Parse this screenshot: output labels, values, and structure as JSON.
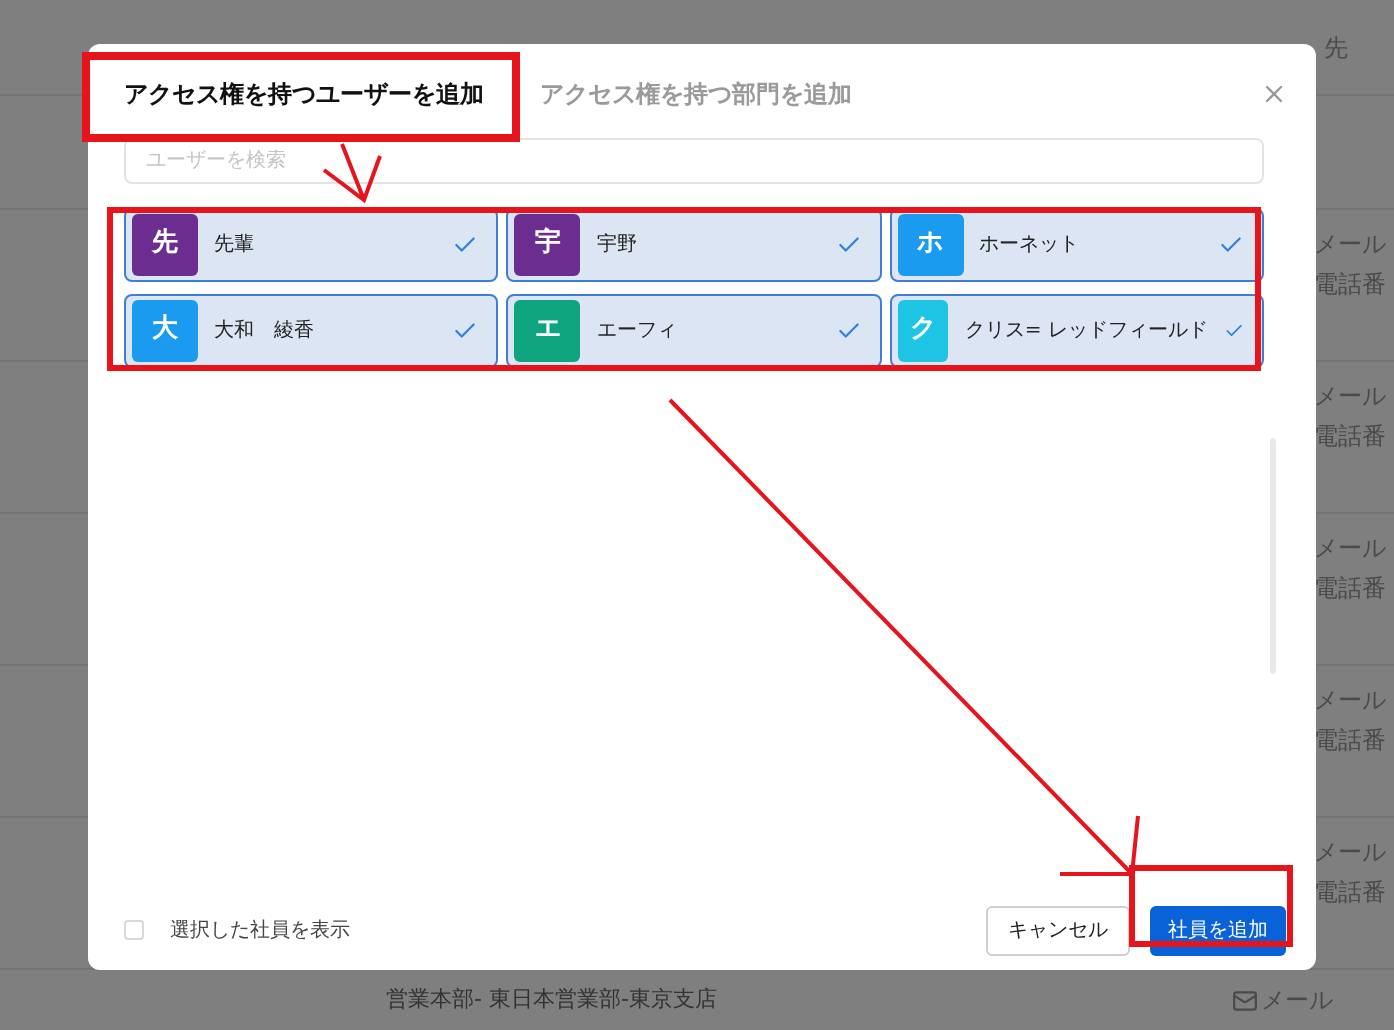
{
  "background": {
    "header_text": "先",
    "rows": [
      {
        "email": "メール",
        "phone": "電話番"
      },
      {
        "email": "メール",
        "phone": "電話番"
      },
      {
        "email": "メール",
        "phone": "電話番"
      },
      {
        "email": "メール",
        "phone": "電話番"
      },
      {
        "email": "メール",
        "phone": "電話番"
      }
    ],
    "last_row": {
      "department": "営業本部- 東日本営業部-東京支店",
      "email": "メール"
    }
  },
  "dialog": {
    "tabs": [
      {
        "label": "アクセス権を持つユーザーを追加",
        "selected": true
      },
      {
        "label": "アクセス権を持つ部門を追加",
        "selected": false
      }
    ],
    "search": {
      "placeholder": "ユーザーを検索"
    },
    "users": [
      {
        "initial": "先",
        "name": "先輩",
        "color": "#6b2d8f",
        "checked": true
      },
      {
        "initial": "宇",
        "name": "宇野",
        "color": "#6b2d8f",
        "checked": true
      },
      {
        "initial": "ホ",
        "name": "ホーネット",
        "color": "#1a9bf0",
        "checked": true
      },
      {
        "initial": "大",
        "name": "大和　綾香",
        "color": "#1a9bf0",
        "checked": true
      },
      {
        "initial": "エ",
        "name": "エーフィ",
        "color": "#0ea47e",
        "checked": true
      },
      {
        "initial": "ク",
        "name": "クリス= レッドフィールド",
        "color": "#1ec4e4",
        "checked": true
      }
    ],
    "show_selected": {
      "label": "選択した社員を表示",
      "checked": false
    },
    "buttons": [
      {
        "label": "キャンセル",
        "kind": "secondary"
      },
      {
        "label": "社員を追加",
        "kind": "primary"
      }
    ]
  }
}
